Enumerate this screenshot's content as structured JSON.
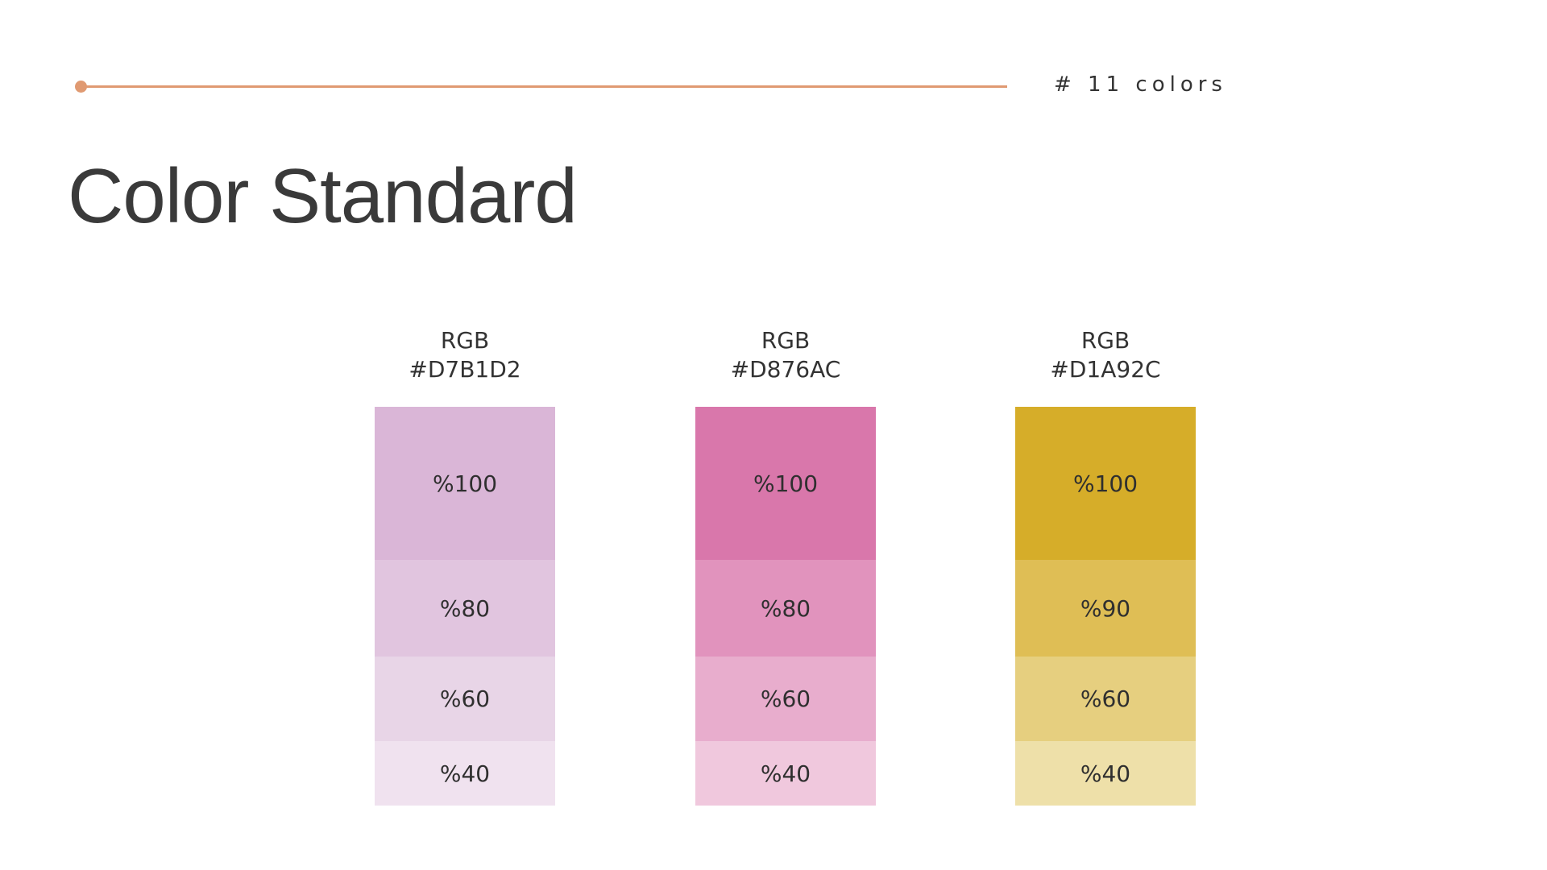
{
  "header": {
    "count_label": "# 11 colors",
    "accent_color": "#e09a72"
  },
  "title": "Color Standard",
  "swatches": [
    {
      "label": "RGB",
      "hex": "#D7B1D2",
      "shades": [
        {
          "label": "%100",
          "color": "#dab6d7"
        },
        {
          "label": "%80",
          "color": "#e1c5df"
        },
        {
          "label": "%60",
          "color": "#e8d5e7"
        },
        {
          "label": "%40",
          "color": "#f0e2ef"
        }
      ]
    },
    {
      "label": "RGB",
      "hex": "#D876AC",
      "shades": [
        {
          "label": "%100",
          "color": "#d977ab"
        },
        {
          "label": "%80",
          "color": "#e193bd"
        },
        {
          "label": "%60",
          "color": "#e8adcd"
        },
        {
          "label": "%40",
          "color": "#f0c8dd"
        }
      ]
    },
    {
      "label": "RGB",
      "hex": "#D1A92C",
      "shades": [
        {
          "label": "%100",
          "color": "#d6ad29"
        },
        {
          "label": "%90",
          "color": "#dfbe55"
        },
        {
          "label": "%60",
          "color": "#e6cf7f"
        },
        {
          "label": "%40",
          "color": "#eee0a9"
        }
      ]
    }
  ]
}
